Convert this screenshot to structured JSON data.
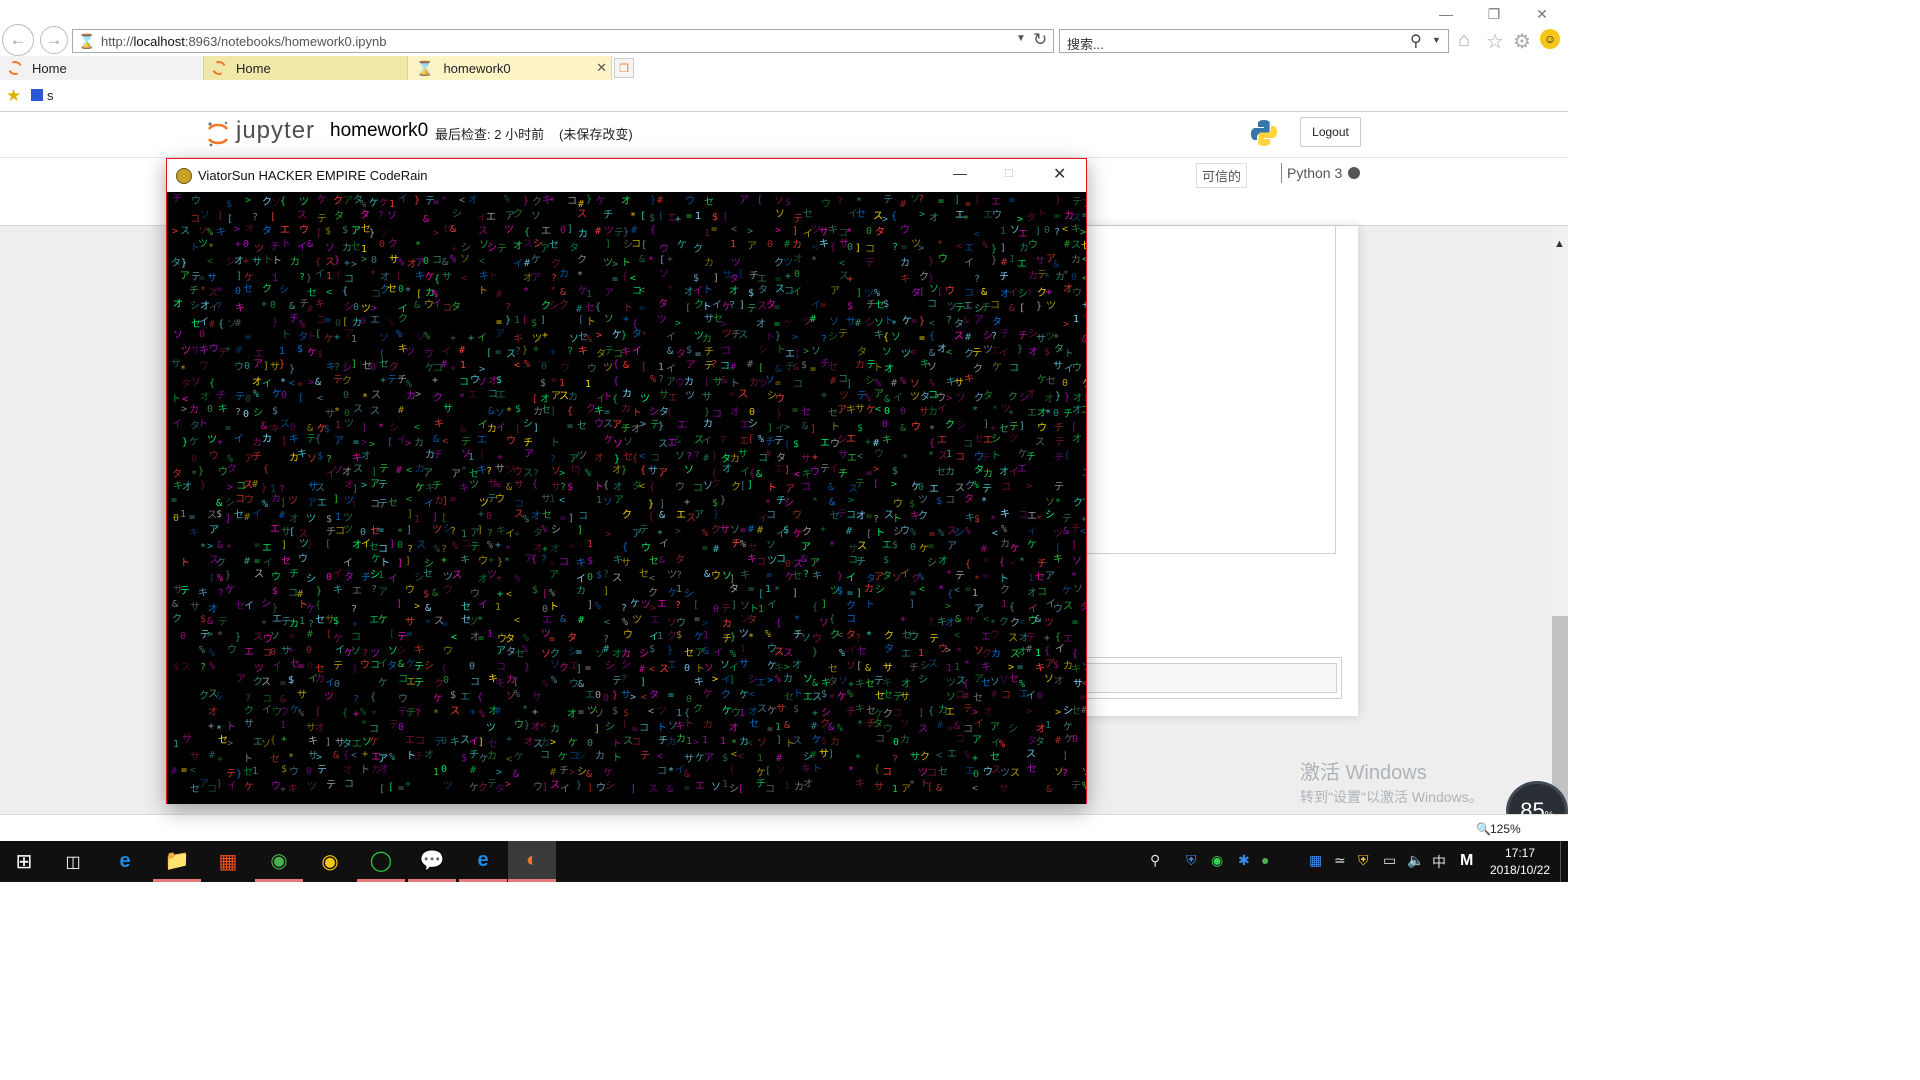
{
  "browser": {
    "url_prefix": "http://",
    "url_host": "localhost",
    "url_path": ":8963/notebooks/homework0.ipynb",
    "search_placeholder": "搜索...",
    "tabs": [
      {
        "label": "Home"
      },
      {
        "label": "Home"
      },
      {
        "label": "homework0"
      }
    ],
    "favorites": [
      {
        "label": "s"
      }
    ]
  },
  "jupyter": {
    "logo_text": "jupyter",
    "notebook_name": "homework0",
    "checkpoint": "最后检查: 2 小时前",
    "unsaved": "(未保存改变)",
    "logout_label": "Logout",
    "trusted_label": "可信的",
    "kernel_label": "Python 3"
  },
  "coderain": {
    "title": "ViatorSun HACKER EMPIRE CodeRain",
    "colors": [
      "#2ecc40",
      "#39cccc",
      "#b10dc9",
      "#ff4136",
      "#7fdbff",
      "#01ff70",
      "#f012be",
      "#ffdc00",
      "#0074d9",
      "#3d9970",
      "#85144b",
      "#aaaaaa"
    ]
  },
  "watermark": {
    "line1": "激活 Windows",
    "line2": "转到\"设置\"以激活 Windows。"
  },
  "status": {
    "zoom": "125%",
    "speed": "85",
    "speed_unit": "%"
  },
  "taskbar": {
    "ime": "中",
    "time": "17:17",
    "date": "2018/10/22"
  }
}
